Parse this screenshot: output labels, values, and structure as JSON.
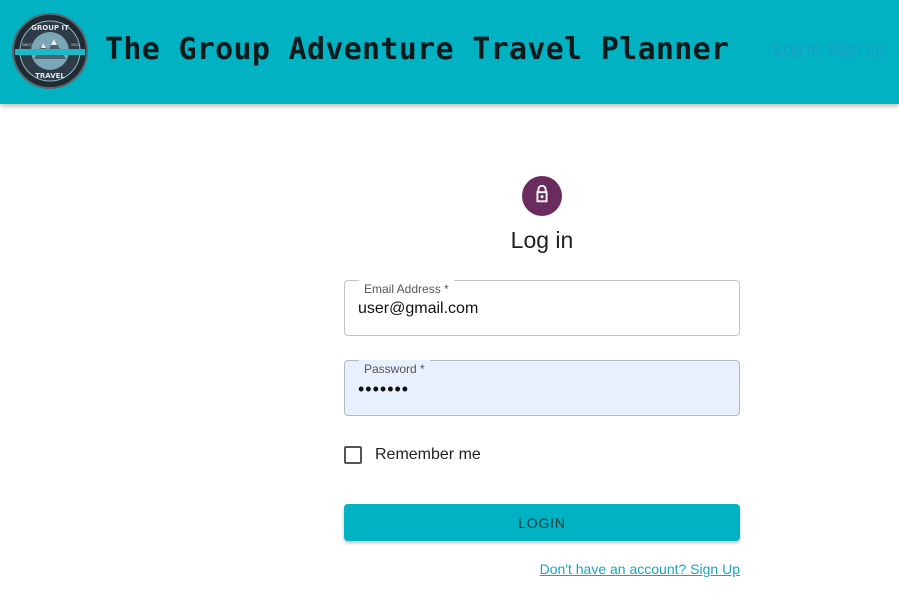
{
  "header": {
    "logo": {
      "top_text": "GROUP IT",
      "bottom_text": "TRAVEL",
      "left_small": "SINCE",
      "right_small": "2022"
    },
    "title": "The Group Adventure Travel Planner",
    "nav": {
      "login": "Log in",
      "signup": "Sign up"
    }
  },
  "form": {
    "icon": "lock-icon",
    "title": "Log in",
    "email": {
      "label": "Email Address *",
      "value": "user@gmail.com"
    },
    "password": {
      "label": "Password *",
      "value": "•••••••"
    },
    "remember_label": "Remember me",
    "submit_label": "LOGIN",
    "signup_link": "Don't have an account? Sign Up"
  },
  "colors": {
    "primary": "#00b2c2",
    "avatar": "#6a2c5f",
    "link": "#1aa3c0",
    "autofill": "#e8f0fe"
  }
}
